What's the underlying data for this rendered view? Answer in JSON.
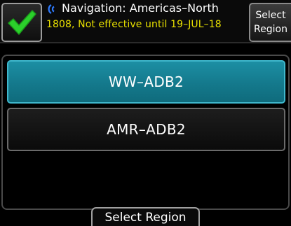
{
  "header": {
    "nav_title": "Navigation: Americas–North",
    "nav_status": "1808, Not effective until 19–JUL–18",
    "select_region_line1": "Select",
    "select_region_line2": "Region"
  },
  "regions": {
    "items": [
      {
        "label": "WW–ADB2",
        "selected": true
      },
      {
        "label": "AMR–ADB2",
        "selected": false
      }
    ]
  },
  "footer": {
    "page_tab": "Select Region"
  },
  "colors": {
    "check": "#2bd02b",
    "status_text": "#e8e000",
    "selected_item": "#14798c",
    "signal_icon": "#2f7bff"
  },
  "icons": {
    "confirm": "check-icon",
    "database": "signal-icon"
  }
}
